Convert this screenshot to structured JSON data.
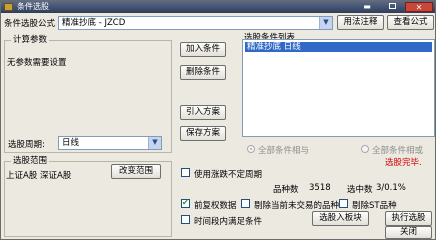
{
  "window": {
    "title": "条件选股"
  },
  "formula": {
    "label": "条件选股公式",
    "value": "精准抄底  - JZCD",
    "btn_usage": "用法注释",
    "btn_view": "查看公式"
  },
  "params": {
    "group_title": "计算参数",
    "none_text": "无参数需要设置",
    "period_label": "选股周期:",
    "period_value": "日线"
  },
  "actions": {
    "add": "加入条件",
    "delete": "删除条件",
    "import": "引入方案",
    "save": "保存方案"
  },
  "conditions": {
    "list_title": "选股条件列表",
    "items": [
      "精准抄底  日线"
    ]
  },
  "logic": {
    "and_label": "全部条件相与",
    "or_label": "全部条件相或"
  },
  "status": {
    "done": "选股完毕."
  },
  "scope": {
    "group_title": "选股范围",
    "text": "上证A股 深证A股",
    "btn_change": "改变范围"
  },
  "options": {
    "uncertain_period": "使用涨跌不定周期",
    "prev_data": "前复权数据",
    "exclude_suspended": "剔除当前未交易的品种",
    "exclude_st": "剔除ST品种",
    "in_period": "时间段内满足条件"
  },
  "counts": {
    "total_label": "品种数",
    "total_value": "3518",
    "selected_label": "选中数",
    "selected_value": "3/0.1%"
  },
  "buttons": {
    "add_to_block": "选股入板块",
    "run": "执行选股",
    "close": "关闭"
  },
  "colors": {
    "title_bar": "#3d4a66",
    "status_red": "#d40000",
    "selection": "#3169c6",
    "check_green": "#21a121"
  }
}
